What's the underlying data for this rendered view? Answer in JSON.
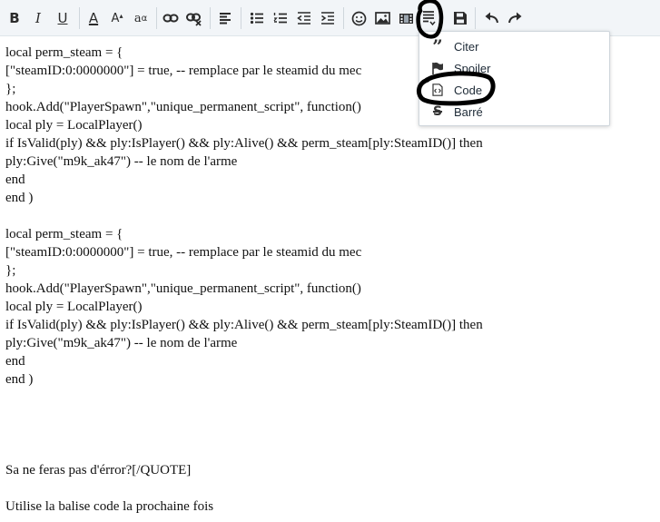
{
  "toolbar": {
    "bold": "B",
    "italic": "I",
    "underline": "U",
    "text_color": "A",
    "font_size": "A",
    "font_family": "a"
  },
  "dropdown": {
    "items": [
      {
        "label": "Citer",
        "icon": "quote-icon"
      },
      {
        "label": "Spoiler",
        "icon": "flag-icon"
      },
      {
        "label": "Code",
        "icon": "code-icon"
      },
      {
        "label": "Barré",
        "icon": "strikethrough-icon"
      }
    ]
  },
  "editor": {
    "lines": [
      "local perm_steam = {",
      "[\"steamID:0:0000000\"] = true, -- remplace par le steamid du mec",
      "};",
      "hook.Add(\"PlayerSpawn\",\"unique_permanent_script\", function()",
      "local ply = LocalPlayer()",
      "if IsValid(ply) && ply:IsPlayer() && ply:Alive() && perm_steam[ply:SteamID()] then",
      "ply:Give(\"m9k_ak47\") -- le nom de l'arme",
      "end",
      "end )",
      "",
      "local perm_steam = {",
      "[\"steamID:0:0000000\"] = true, -- remplace par le steamid du mec",
      "};",
      "hook.Add(\"PlayerSpawn\",\"unique_permanent_script\", function()",
      "local ply = LocalPlayer()",
      "if IsValid(ply) && ply:IsPlayer() && ply:Alive() && perm_steam[ply:SteamID()] then",
      "ply:Give(\"m9k_ak47\") -- le nom de l'arme",
      "end",
      "end )",
      "",
      "",
      "",
      "",
      "Sa ne feras pas d'érror?[/QUOTE]",
      "",
      "Utilise la balise code la prochaine fois"
    ]
  },
  "colors": {
    "toolbar_bg": "#f2f5f8",
    "annotation_ink": "#000000",
    "text": "#111111"
  }
}
